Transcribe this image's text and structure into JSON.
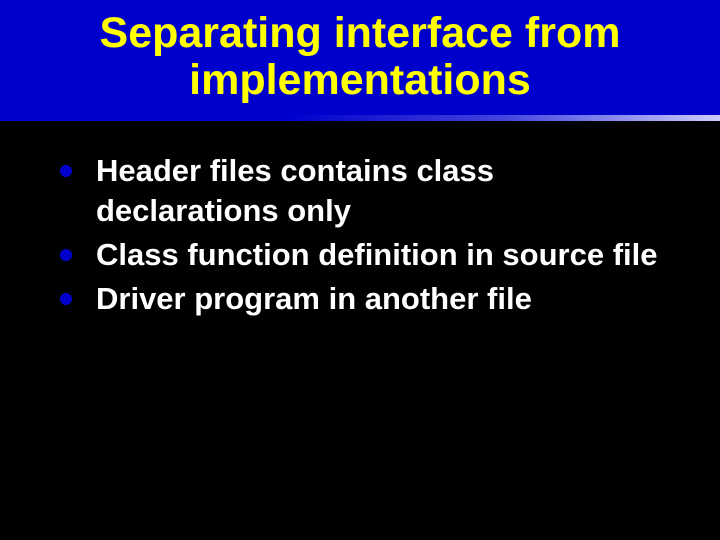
{
  "slide": {
    "title": "Separating interface from implementations",
    "bullets": [
      "Header files contains class declarations only",
      "Class function definition in source file",
      "Driver program in another file"
    ]
  },
  "colors": {
    "background": "#000000",
    "titleBand": "#0000cc",
    "titleText": "#ffff00",
    "bodyText": "#ffffff",
    "bulletDot": "#0000cc"
  }
}
